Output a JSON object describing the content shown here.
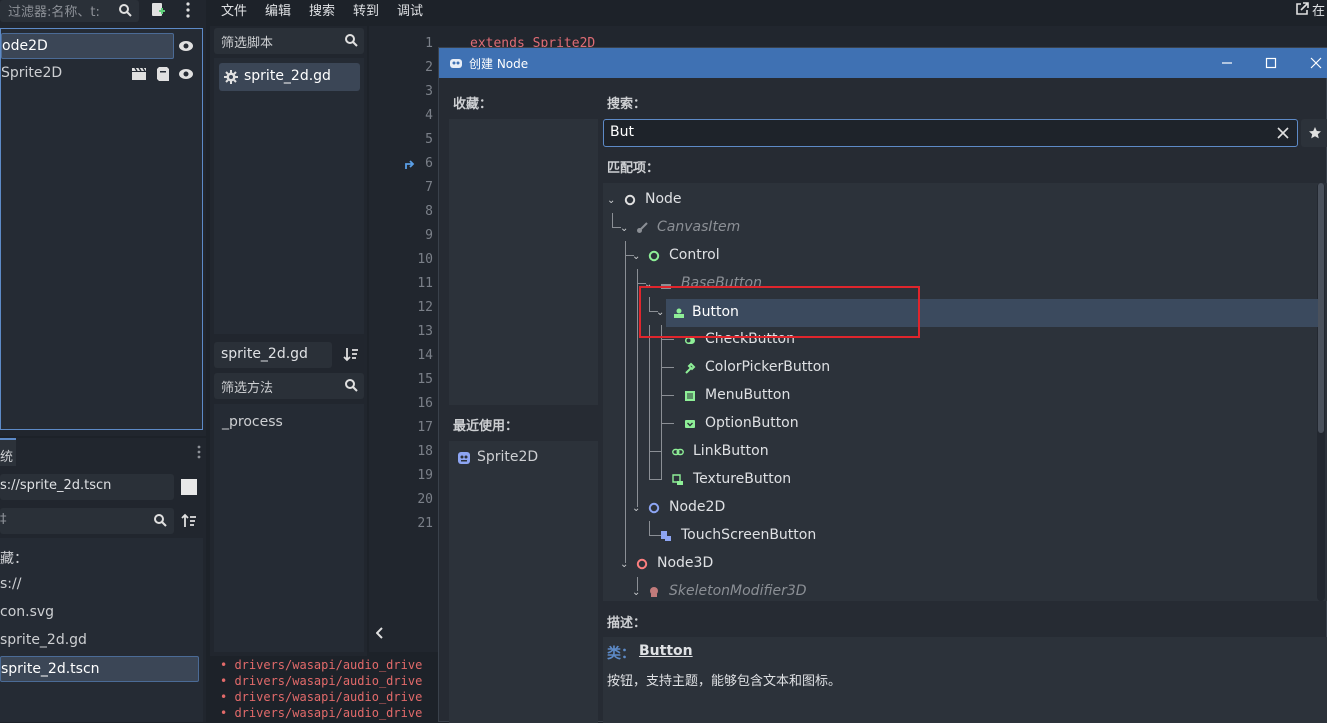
{
  "scene_dock": {
    "filter_placeholder": "过滤器:名称、t:",
    "items": [
      {
        "label": "ode2D"
      },
      {
        "label": "Sprite2D"
      }
    ]
  },
  "fs_dock": {
    "tab_label": "统",
    "path_value": "s://sprite_2d.tscn",
    "filter_placeholder": "‡",
    "favorites_label": "藏：",
    "items": [
      {
        "label": "s://"
      },
      {
        "label": "con.svg"
      },
      {
        "label": "sprite_2d.gd"
      },
      {
        "label": "sprite_2d.tscn"
      }
    ]
  },
  "menubar": {
    "items": [
      "文件",
      "编辑",
      "搜索",
      "转到",
      "调试"
    ],
    "right_label": "在"
  },
  "script_panel": {
    "filter_scripts": "筛选脚本",
    "script_item": "sprite_2d.gd",
    "current_script": "sprite_2d.gd",
    "filter_methods": "筛选方法",
    "method_item": "_process"
  },
  "editor": {
    "lines": [
      "1",
      "2",
      "3",
      "4",
      "5",
      "6",
      "7",
      "8",
      "9",
      "10",
      "11",
      "12",
      "13",
      "14",
      "15",
      "16",
      "17",
      "18",
      "19",
      "20",
      "21"
    ],
    "code_first_line": "extends Sprite2D"
  },
  "log": {
    "lines": [
      "• drivers/wasapi/audio_drive",
      "• drivers/wasapi/audio_drive",
      "• drivers/wasapi/audio_drive",
      "• drivers/wasapi/audio_drive"
    ]
  },
  "dialog": {
    "title": "创建 Node",
    "favorites_label": "收藏：",
    "recent_label": "最近使用：",
    "recent_items": [
      "Sprite2D"
    ],
    "search_label": "搜索：",
    "search_value": "But",
    "matches_label": "匹配项：",
    "tree": [
      {
        "label": "Node"
      },
      {
        "label": "CanvasItem"
      },
      {
        "label": "Control"
      },
      {
        "label": "BaseButton"
      },
      {
        "label": "Button"
      },
      {
        "label": "CheckButton"
      },
      {
        "label": "ColorPickerButton"
      },
      {
        "label": "MenuButton"
      },
      {
        "label": "OptionButton"
      },
      {
        "label": "LinkButton"
      },
      {
        "label": "TextureButton"
      },
      {
        "label": "Node2D"
      },
      {
        "label": "TouchScreenButton"
      },
      {
        "label": "Node3D"
      },
      {
        "label": "SkeletonModifier3D"
      }
    ],
    "description_label": "描述：",
    "class_prefix": "类：",
    "class_name": "Button",
    "description_text": "按钮，支持主题，能够包含文本和图标。"
  },
  "colors": {
    "accent": "#3f71b3",
    "highlight_box": "#e0252c",
    "selection": "#3b4656"
  }
}
